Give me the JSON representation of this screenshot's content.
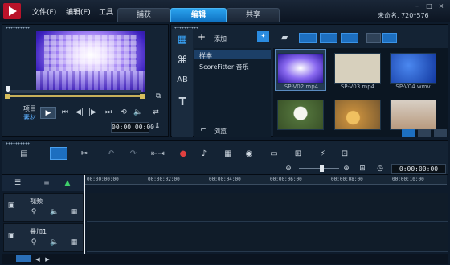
{
  "menubar": {
    "file": "文件(F)",
    "edit": "编辑(E)",
    "tools": "工具"
  },
  "tabs": [
    "捕获",
    "编辑",
    "共享"
  ],
  "status": "未命名, 720*576",
  "player": {
    "project_label": "项目",
    "clip_label": "素材",
    "timecode": "00:00:00:00"
  },
  "library": {
    "add_label": "添加",
    "items": [
      "样本",
      "ScoreFitter 音乐"
    ],
    "browse_label": "浏览"
  },
  "thumbnails": [
    {
      "name": "SP-V02.mp4",
      "color": "#6c4de0"
    },
    {
      "name": "SP-V03.mp4",
      "color": "#d7d0bd"
    },
    {
      "name": "SP-V04.wmv",
      "color": "#1f55c8"
    },
    {
      "name": "",
      "color": "#4c6a3c"
    },
    {
      "name": "",
      "color": "#d8a94c"
    },
    {
      "name": "",
      "color": "#cfc4b8"
    }
  ],
  "timeline": {
    "duration": "0:00:00:00",
    "ruler": [
      "00:00:00:00",
      "00:00:02:00",
      "00:00:04:00",
      "00:00:06:00",
      "00:00:08:00",
      "00:00:10:00"
    ],
    "tracks": [
      "视频",
      "叠加1"
    ]
  },
  "colors": {
    "accent": "#1d8ad9",
    "brand": "#b9132a"
  }
}
